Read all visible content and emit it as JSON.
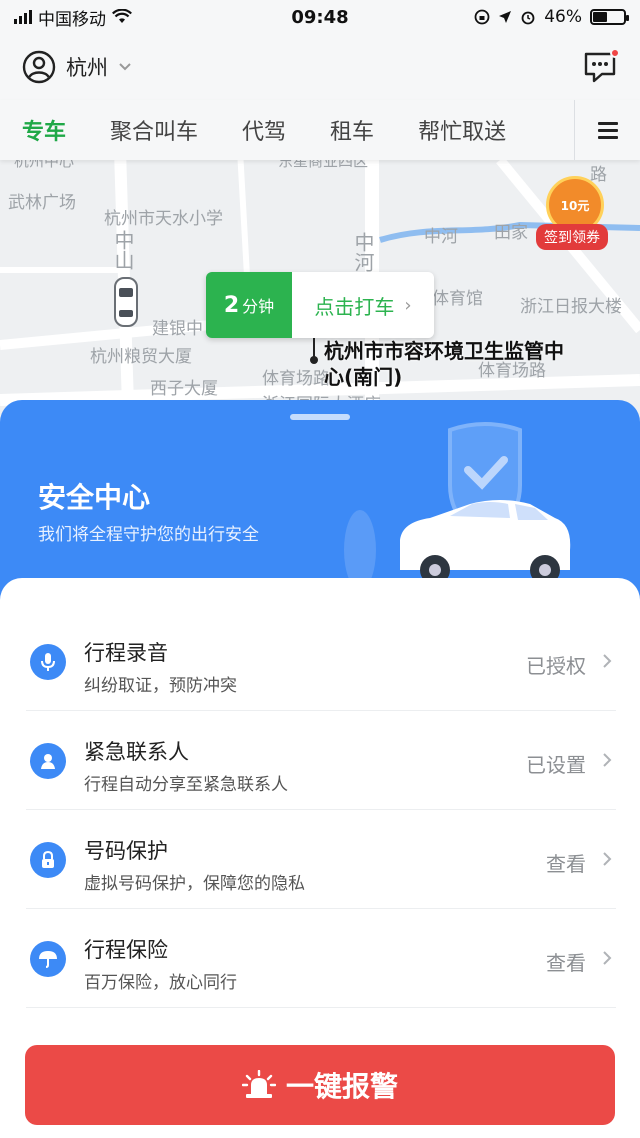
{
  "status_bar": {
    "carrier": "中国移动",
    "time": "09:48",
    "battery_percent": "46%",
    "battery_level": 0.46
  },
  "header": {
    "city": "杭州",
    "icons": [
      "user-avatar-icon",
      "chevron-down-icon",
      "message-icon"
    ]
  },
  "tabs": [
    {
      "label": "专车",
      "active": true
    },
    {
      "label": "聚合叫车",
      "active": false
    },
    {
      "label": "代驾",
      "active": false
    },
    {
      "label": "租车",
      "active": false
    },
    {
      "label": "帮忙取送",
      "active": false
    }
  ],
  "map": {
    "labels": {
      "wulin": "武林广场",
      "tianshui": "杭州市天水小学",
      "zhongshan": "中山",
      "zhonghe_v": "中河",
      "zhonghe_h": "中河",
      "tianjia": "田家",
      "tiyuguan": "体育馆",
      "zhejiang_daily": "浙江日报大楼",
      "jianyin": "建银中",
      "liangmao": "杭州粮贸大厦",
      "xizi": "西子大厦",
      "tiyuchang": "体育场路",
      "tiyuchang_rd": "体育场路",
      "top_cut": "杭州中心",
      "top_cut2": "东星商业四区",
      "lu": "路",
      "bottom_cut": "浙江国际大酒店"
    },
    "eta_value": "2",
    "eta_unit": "分钟",
    "call_label": "点击打车",
    "destination": "杭州市市容环境卫生监管中心(南门)",
    "promo_coin": "10元",
    "promo_label": "签到领券"
  },
  "safety": {
    "title": "安全中心",
    "subtitle": "我们将全程守护您的出行安全",
    "items": [
      {
        "title": "行程录音",
        "desc": "纠纷取证，预防冲突",
        "status": "已授权",
        "icon": "microphone-icon"
      },
      {
        "title": "紧急联系人",
        "desc": "行程自动分享至紧急联系人",
        "status": "已设置",
        "icon": "person-icon"
      },
      {
        "title": "号码保护",
        "desc": "虚拟号码保护，保障您的隐私",
        "status": "查看",
        "icon": "lock-icon"
      },
      {
        "title": "行程保险",
        "desc": "百万保险，放心同行",
        "status": "查看",
        "icon": "umbrella-icon"
      }
    ],
    "sos_label": "一键报警"
  },
  "colors": {
    "brand_green": "#1fa847",
    "safety_blue": "#3d8af6",
    "sos_red": "#eb4a47"
  }
}
